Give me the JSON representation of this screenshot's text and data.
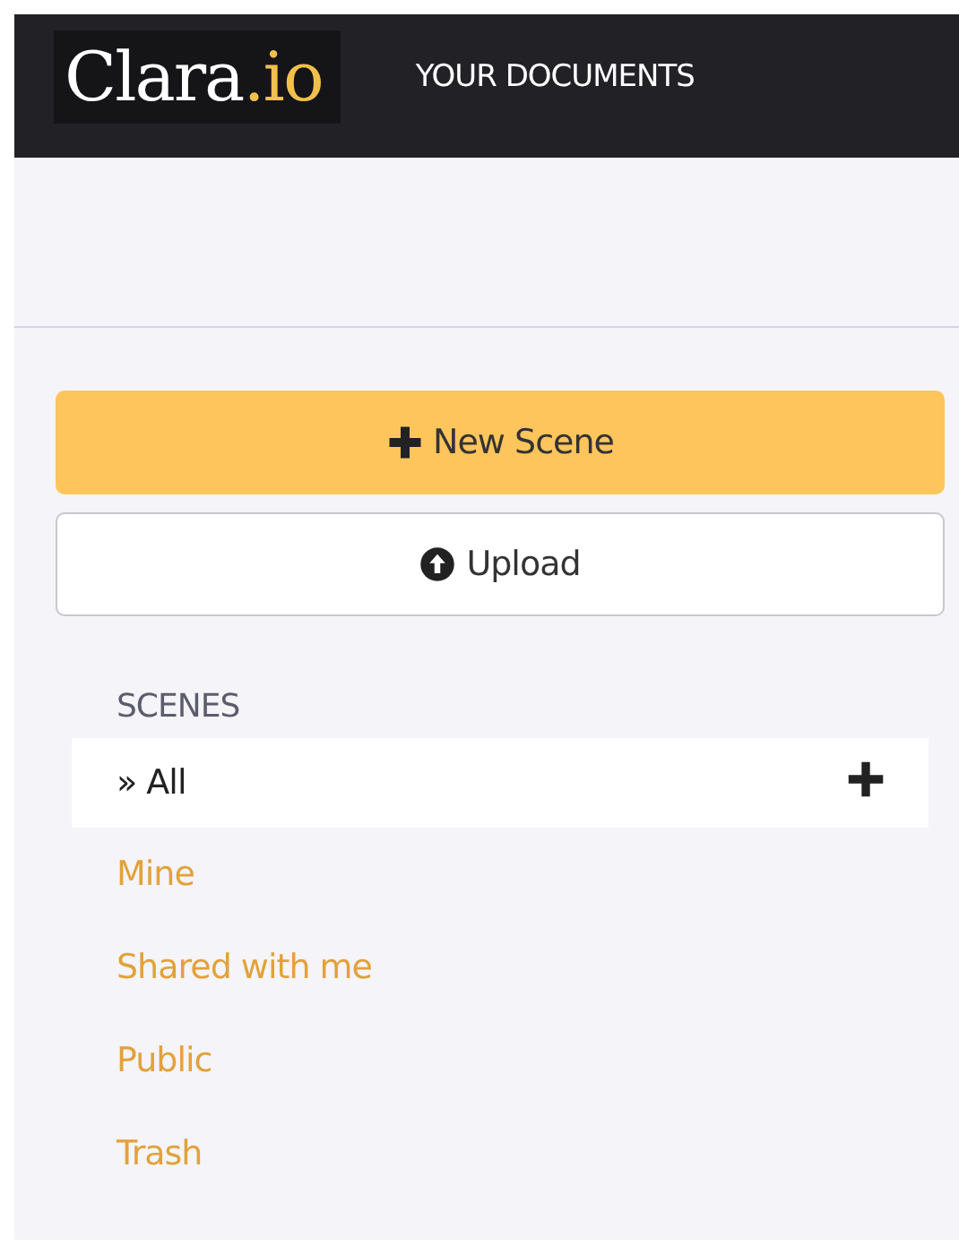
{
  "header": {
    "logo": {
      "text": "Clara",
      "accent": ".io"
    },
    "nav_link": "YOUR DOCUMENTS"
  },
  "buttons": [
    {
      "kind": "primary",
      "label": "New Scene"
    },
    {
      "kind": "secondary",
      "label": "Upload"
    }
  ],
  "scenes": {
    "heading": "SCENES",
    "items": [
      {
        "label": "» All",
        "selected": true,
        "add_button": true
      },
      {
        "label": "Mine",
        "selected": false
      },
      {
        "label": "Shared with me",
        "selected": false
      },
      {
        "label": "Public",
        "selected": false
      },
      {
        "label": "Trash",
        "selected": false
      }
    ]
  }
}
